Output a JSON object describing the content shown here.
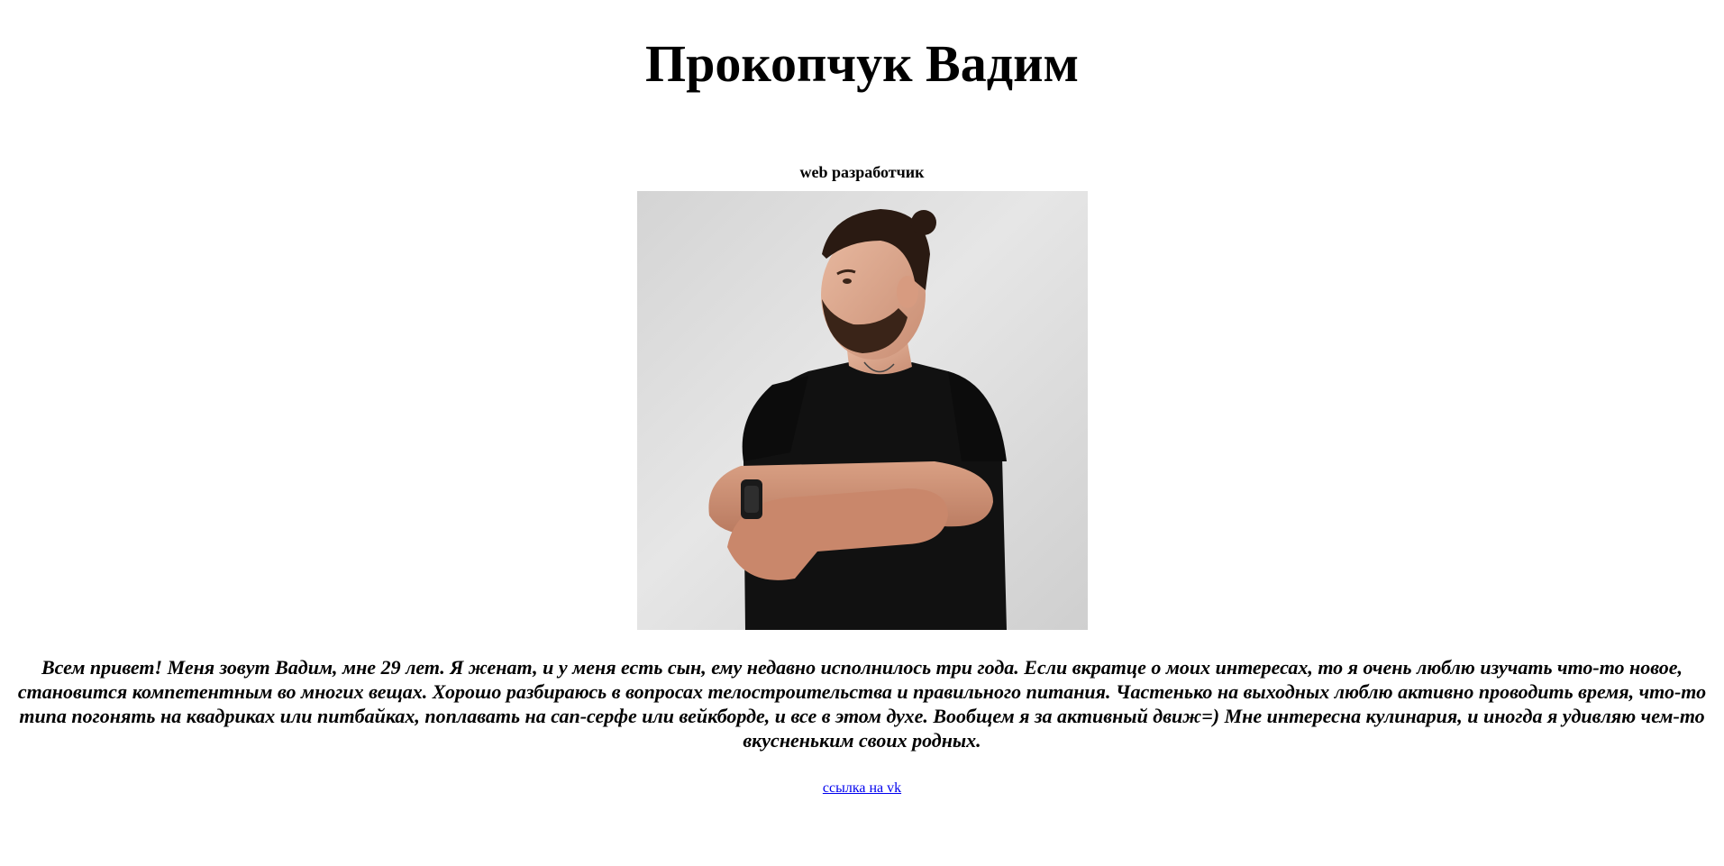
{
  "profile": {
    "name": "Прокопчук Вадим",
    "role": "web разработчик",
    "photo_icon": "portrait-photo",
    "bio": "Всем привет! Меня зовут Вадим, мне 29 лет. Я женат, и у меня есть сын, ему недавно исполнилось три года. Если вкратце о моих интересах, то я очень люблю изучать что-то новое, становится компетентным во многих вещах. Хорошо разбираюсь в вопросах телостроительства и правильного питания. Частенько на выходных люблю активно проводить время, что-то типа погонять на квадриках или питбайках, поплавать на сап-серфе или вейкборде, и все в этом духе. Вообщем я за активный движ=) Мне интересна кулинария, и иногда я удивляю чем-то вкусненьким своих родных.",
    "link_text": "ссылка на vk"
  },
  "colors": {
    "text": "#000000",
    "link": "#0000ee",
    "background": "#ffffff"
  }
}
